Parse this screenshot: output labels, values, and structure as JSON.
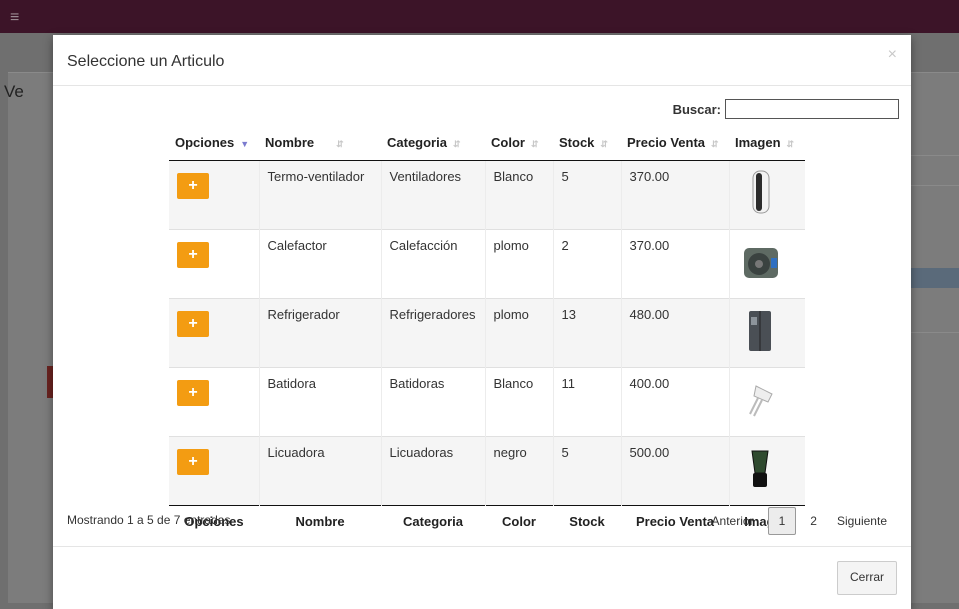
{
  "background": {
    "page_title": "Ve"
  },
  "modal": {
    "title": "Seleccione un Articulo",
    "close_icon": "×",
    "search_label": "Buscar:",
    "search_value": "",
    "columns": [
      "Opciones",
      "Nombre",
      "Categoria",
      "Color",
      "Stock",
      "Precio Venta",
      "Imagen"
    ],
    "add_icon": "+",
    "rows": [
      {
        "nombre": "Termo-ventilador",
        "categoria": "Ventiladores",
        "color": "Blanco",
        "stock": "5",
        "precio": "370.00",
        "imagen": "heater-tower-image"
      },
      {
        "nombre": "Calefactor",
        "categoria": "Calefacción",
        "color": "plomo",
        "stock": "2",
        "precio": "370.00",
        "imagen": "fan-heater-image"
      },
      {
        "nombre": "Refrigerador",
        "categoria": "Refrigeradores",
        "color": "plomo",
        "stock": "13",
        "precio": "480.00",
        "imagen": "refrigerator-image"
      },
      {
        "nombre": "Batidora",
        "categoria": "Batidoras",
        "color": "Blanco",
        "stock": "11",
        "precio": "400.00",
        "imagen": "hand-mixer-image"
      },
      {
        "nombre": "Licuadora",
        "categoria": "Licuadoras",
        "color": "negro",
        "stock": "5",
        "precio": "500.00",
        "imagen": "blender-image"
      }
    ],
    "info": "Mostrando 1 a 5 de 7 entradas",
    "pagination": {
      "previous": "Anterior",
      "pages": [
        "1",
        "2"
      ],
      "current": "1",
      "next": "Siguiente"
    },
    "close_button": "Cerrar"
  },
  "colors": {
    "add_button": "#f39c12",
    "topbar": "#3c1428"
  }
}
